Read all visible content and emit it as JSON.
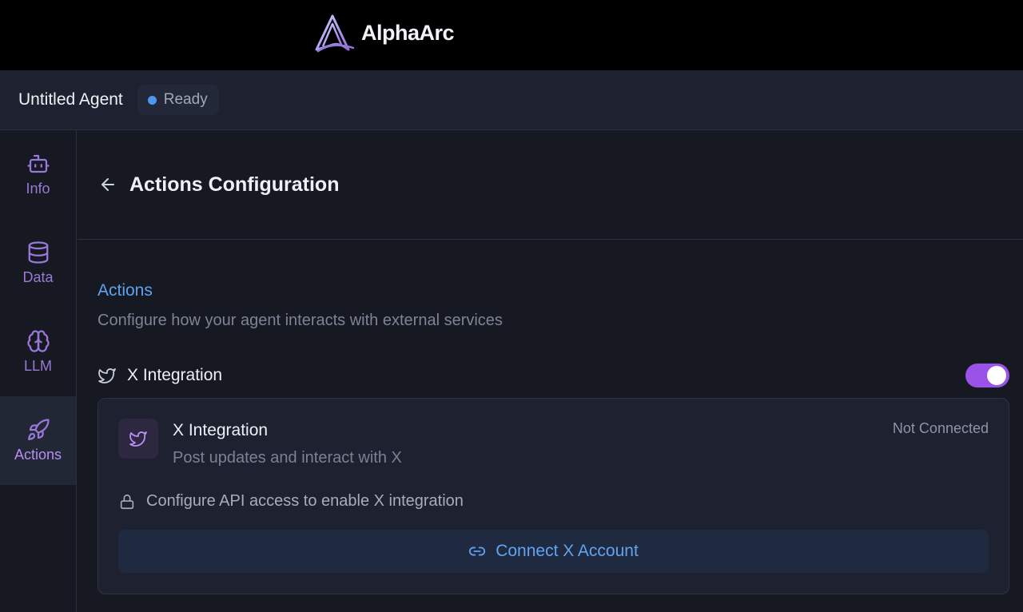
{
  "brand": {
    "name": "AlphaArc",
    "logo_icon": "alphaarc-logo-icon"
  },
  "agent": {
    "name": "Untitled Agent",
    "status": "Ready",
    "status_color": "#4e97ef"
  },
  "sidebar": {
    "items": [
      {
        "label": "Info",
        "icon": "robot-icon",
        "active": false
      },
      {
        "label": "Data",
        "icon": "database-icon",
        "active": false
      },
      {
        "label": "LLM",
        "icon": "brain-icon",
        "active": false
      },
      {
        "label": "Actions",
        "icon": "rocket-icon",
        "active": true
      }
    ]
  },
  "header": {
    "title": "Actions Configuration",
    "back_icon": "arrow-left-icon"
  },
  "section": {
    "title": "Actions",
    "description": "Configure how your agent interacts with external services"
  },
  "integration": {
    "name": "X Integration",
    "icon": "twitter-bird-icon",
    "enabled": true,
    "toggle_color": "#9b52e8"
  },
  "card": {
    "title": "X Integration",
    "subtitle": "Post updates and interact with X",
    "status": "Not Connected",
    "notice": "Configure API access to enable X integration",
    "notice_icon": "lock-icon",
    "button_label": "Connect X Account",
    "button_icon": "link-icon"
  },
  "colors": {
    "accent_purple": "#9b52e8",
    "accent_blue": "#5fa2f0",
    "background": "#161922"
  }
}
